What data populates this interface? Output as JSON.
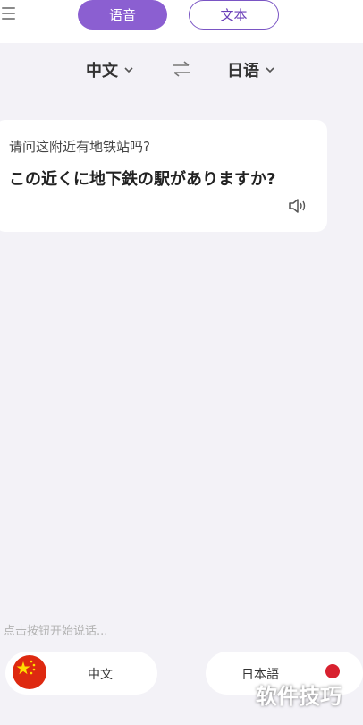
{
  "header": {
    "tabs": [
      {
        "label": "语音",
        "active": true
      },
      {
        "label": "文本",
        "active": false
      }
    ]
  },
  "languages": {
    "source": "中文",
    "target": "日语"
  },
  "translation": {
    "source_text": "请问这附近有地铁站吗?",
    "target_text": "この近くに地下鉄の駅がありますか?"
  },
  "footer": {
    "hint": "点击按钮开始说话...",
    "left_button_label": "中文",
    "right_button_label": "日本語"
  },
  "watermark": "软件技巧",
  "colors": {
    "accent": "#8b5fd1",
    "background": "#f3f2f7",
    "flag_cn": "#de2910",
    "flag_jp_dot": "#d8212f"
  }
}
